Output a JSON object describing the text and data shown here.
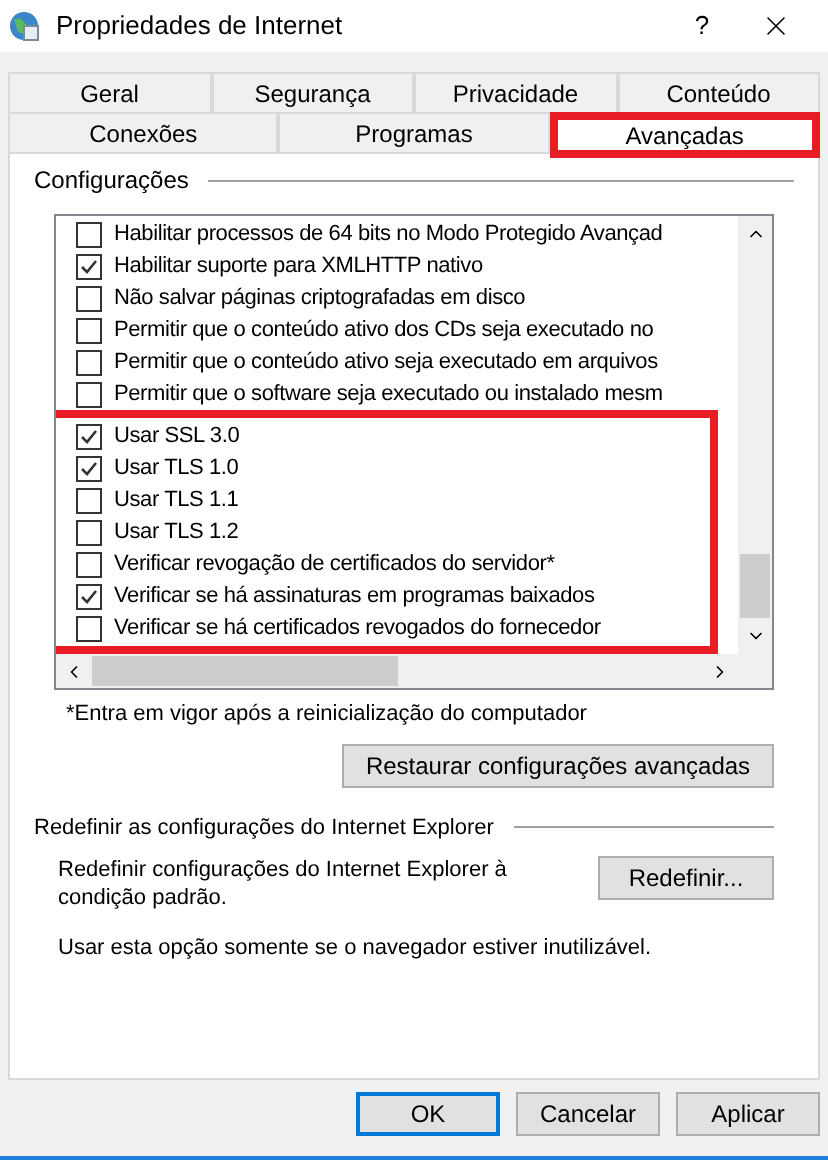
{
  "window": {
    "title": "Propriedades de Internet",
    "help": "?"
  },
  "tab_rows": [
    [
      {
        "label": "Geral",
        "selected": false,
        "highlighted": false
      },
      {
        "label": "Segurança",
        "selected": false,
        "highlighted": false
      },
      {
        "label": "Privacidade",
        "selected": false,
        "highlighted": false
      },
      {
        "label": "Conteúdo",
        "selected": false,
        "highlighted": false
      }
    ],
    [
      {
        "label": "Conexões",
        "selected": false,
        "highlighted": false
      },
      {
        "label": "Programas",
        "selected": false,
        "highlighted": false
      },
      {
        "label": "Avançadas",
        "selected": true,
        "highlighted": true
      }
    ]
  ],
  "settings": {
    "title": "Configurações",
    "groups": [
      {
        "highlighted": false,
        "items": [
          {
            "label": "Habilitar processos de 64 bits no Modo Protegido Avançad",
            "checked": false
          },
          {
            "label": "Habilitar suporte para XMLHTTP nativo",
            "checked": true
          },
          {
            "label": "Não salvar páginas criptografadas em disco",
            "checked": false
          },
          {
            "label": "Permitir que o conteúdo ativo dos CDs seja executado no",
            "checked": false
          },
          {
            "label": "Permitir que o conteúdo ativo seja executado em arquivos",
            "checked": false
          },
          {
            "label": "Permitir que o software seja executado ou instalado mesm",
            "checked": false
          }
        ]
      },
      {
        "highlighted": true,
        "items": [
          {
            "label": "Usar SSL 3.0",
            "checked": true
          },
          {
            "label": "Usar TLS 1.0",
            "checked": true
          },
          {
            "label": "Usar TLS 1.1",
            "checked": false
          },
          {
            "label": "Usar TLS 1.2",
            "checked": false
          },
          {
            "label": "Verificar revogação de certificados do servidor*",
            "checked": false
          },
          {
            "label": "Verificar se há assinaturas em programas baixados",
            "checked": true
          },
          {
            "label": "Verificar se há certificados revogados do fornecedor",
            "checked": false
          }
        ]
      }
    ],
    "note": "*Entra em vigor após a reinicialização do computador",
    "restore_button": "Restaurar configurações avançadas"
  },
  "reset": {
    "title": "Redefinir as configurações do Internet Explorer",
    "description": "Redefinir configurações do Internet Explorer à condição padrão.",
    "button": "Redefinir...",
    "warning": "Usar esta opção somente se o navegador estiver inutilizável."
  },
  "buttons": [
    {
      "label": "OK",
      "focused": true
    },
    {
      "label": "Cancelar",
      "focused": false
    },
    {
      "label": "Aplicar",
      "focused": false
    }
  ]
}
